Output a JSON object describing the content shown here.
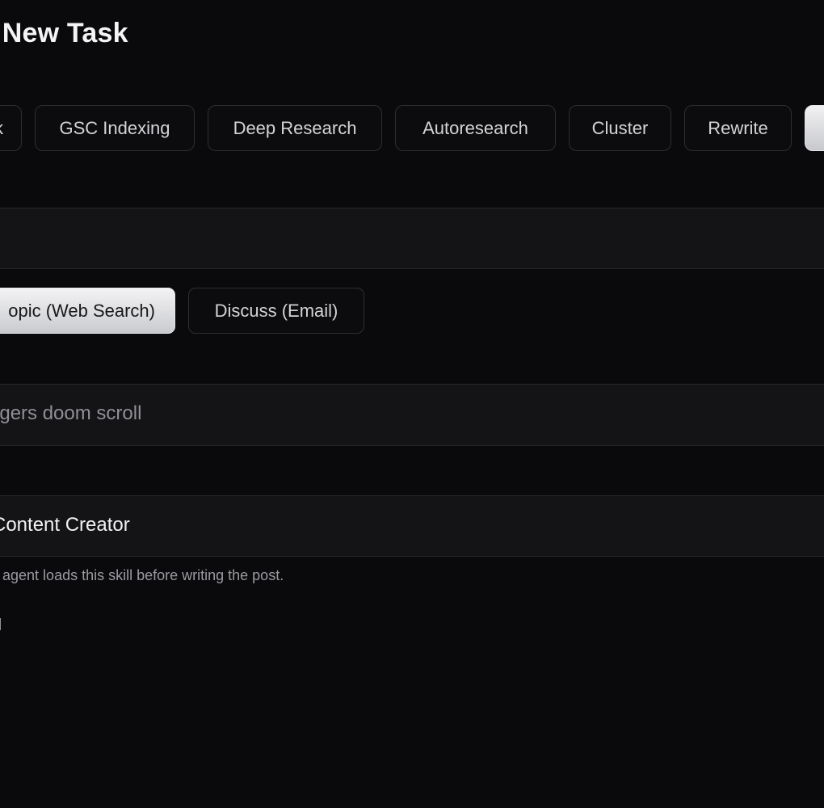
{
  "page_title": "a New Task",
  "task_types": [
    {
      "label": "k",
      "active": false
    },
    {
      "label": "GSC Indexing",
      "active": false
    },
    {
      "label": "Deep Research",
      "active": false
    },
    {
      "label": "Autoresearch",
      "active": false
    },
    {
      "label": "Cluster",
      "active": false
    },
    {
      "label": "Rewrite",
      "active": false
    },
    {
      "label": "",
      "active": true
    }
  ],
  "source_modes": [
    {
      "label": "opic (Web Search)",
      "active": true
    },
    {
      "label": "Discuss (Email)",
      "active": false
    }
  ],
  "topic_input": {
    "value": "agers doom scroll"
  },
  "skill_select": {
    "value": "Content Creator",
    "helper": "e agent loads this skill before writing the post."
  },
  "email_label": "mail",
  "colors": {
    "background": "#0a0a0c",
    "field": "#141416",
    "border": "#2d2e33",
    "active_button_top": "#f1f1f3",
    "active_button_bottom": "#c8c9cd"
  }
}
